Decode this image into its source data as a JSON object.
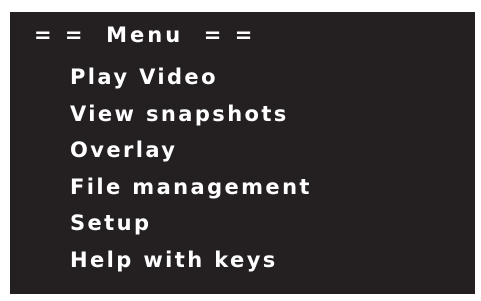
{
  "menu": {
    "title": "= =  Menu  = =",
    "items": [
      {
        "label": "Play Video"
      },
      {
        "label": "View snapshots"
      },
      {
        "label": "Overlay"
      },
      {
        "label": "File management"
      },
      {
        "label": "Setup"
      },
      {
        "label": "Help with keys"
      }
    ]
  },
  "colors": {
    "background": "#242021",
    "text": "#ffffff"
  }
}
